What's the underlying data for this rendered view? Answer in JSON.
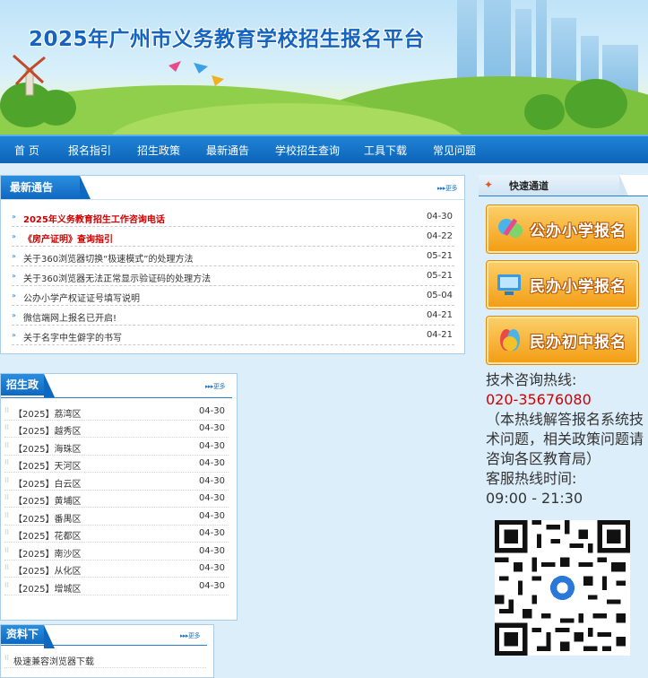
{
  "banner": {
    "title": "2025年广州市义务教育学校招生报名平台"
  },
  "nav": [
    "首 页",
    "报名指引",
    "招生政策",
    "最新通告",
    "学校招生查询",
    "工具下载",
    "常见问题"
  ],
  "news": {
    "title": "最新通告",
    "more": "更多>>",
    "items": [
      {
        "text": "2025年义务教育招生工作咨询电话",
        "date": "04-30",
        "highlight": true
      },
      {
        "text": "《房产证明》查询指引",
        "date": "04-22",
        "highlight": true
      },
      {
        "text": "关于360浏览器切换“极速模式”的处理方法",
        "date": "05-21",
        "highlight": false
      },
      {
        "text": "关于360浏览器无法正常显示验证码的处理方法",
        "date": "05-21",
        "highlight": false
      },
      {
        "text": "公办小学产权证证号填写说明",
        "date": "05-04",
        "highlight": false
      },
      {
        "text": "微信端网上报名已开启!",
        "date": "04-21",
        "highlight": false
      },
      {
        "text": "关于名字中生僻字的书写",
        "date": "04-21",
        "highlight": false
      }
    ]
  },
  "policy": {
    "title": "招生政策",
    "more": "更多>>",
    "items": [
      {
        "text": "【2025】荔湾区",
        "date": "04-30"
      },
      {
        "text": "【2025】越秀区",
        "date": "04-30"
      },
      {
        "text": "【2025】海珠区",
        "date": "04-30"
      },
      {
        "text": "【2025】天河区",
        "date": "04-30"
      },
      {
        "text": "【2025】白云区",
        "date": "04-30"
      },
      {
        "text": "【2025】黄埔区",
        "date": "04-30"
      },
      {
        "text": "【2025】番禺区",
        "date": "04-30"
      },
      {
        "text": "【2025】花都区",
        "date": "04-30"
      },
      {
        "text": "【2025】南沙区",
        "date": "04-30"
      },
      {
        "text": "【2025】从化区",
        "date": "04-30"
      },
      {
        "text": "【2025】增城区",
        "date": "04-30"
      }
    ]
  },
  "downloads": {
    "title": "资料下载",
    "more": "更多>>",
    "items": [
      {
        "text": "极速兼容浏览器下载"
      }
    ]
  },
  "quick": {
    "title": "快速通道",
    "buttons": [
      "公办小学报名",
      "民办小学报名",
      "民办初中报名"
    ]
  },
  "hotline": {
    "label": "技术咨询热线:",
    "phone": "020-35676080",
    "note": "（本热线解答报名系统技术问题，相关政策问题请咨询各区教育局）",
    "hours_label": "客服热线时间:",
    "hours": "09:00 - 21:30"
  },
  "colors": {
    "nav": "#0d63b8",
    "accent": "#1565c0",
    "highlight": "#cc0000",
    "button": "#f39c13"
  }
}
